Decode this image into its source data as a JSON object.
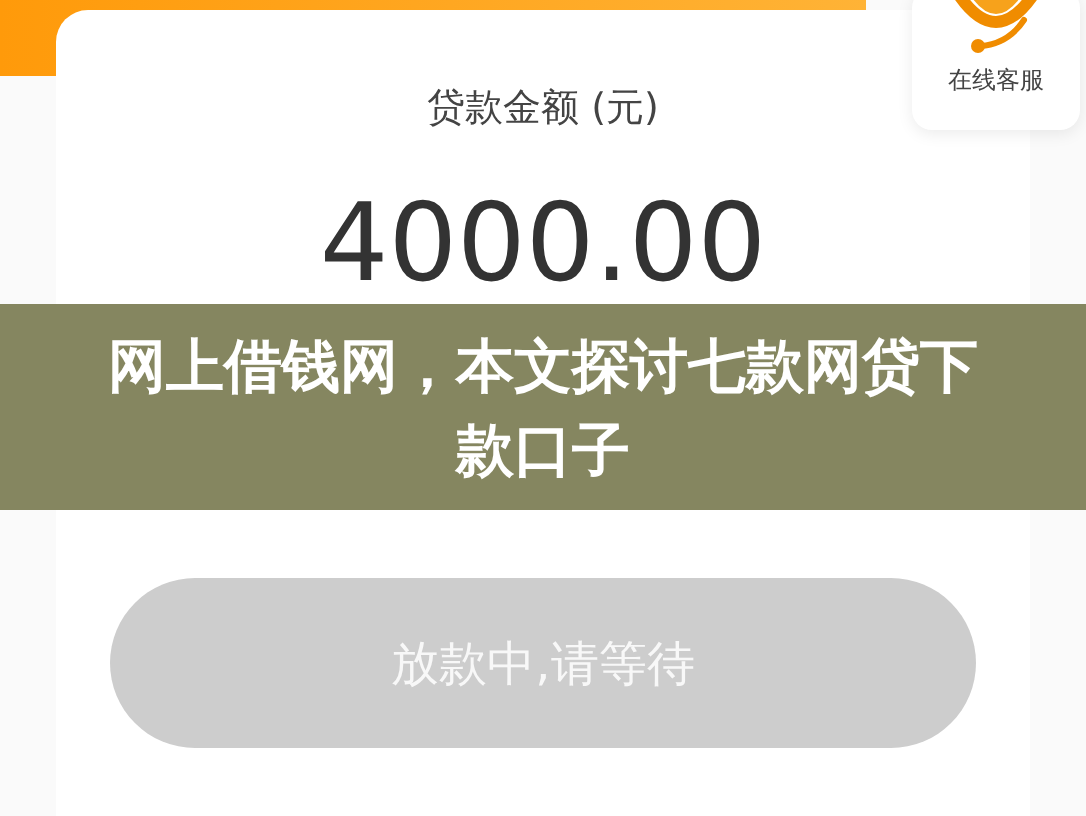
{
  "loan_card": {
    "label": "贷款金额 (元)",
    "amount": "4000.00"
  },
  "service_button": {
    "label": "在线客服"
  },
  "status_button": {
    "label": "放款中,请等待",
    "disabled": true
  },
  "banner": {
    "title": "网上借钱网，本文探讨七款网贷下款口子"
  }
}
